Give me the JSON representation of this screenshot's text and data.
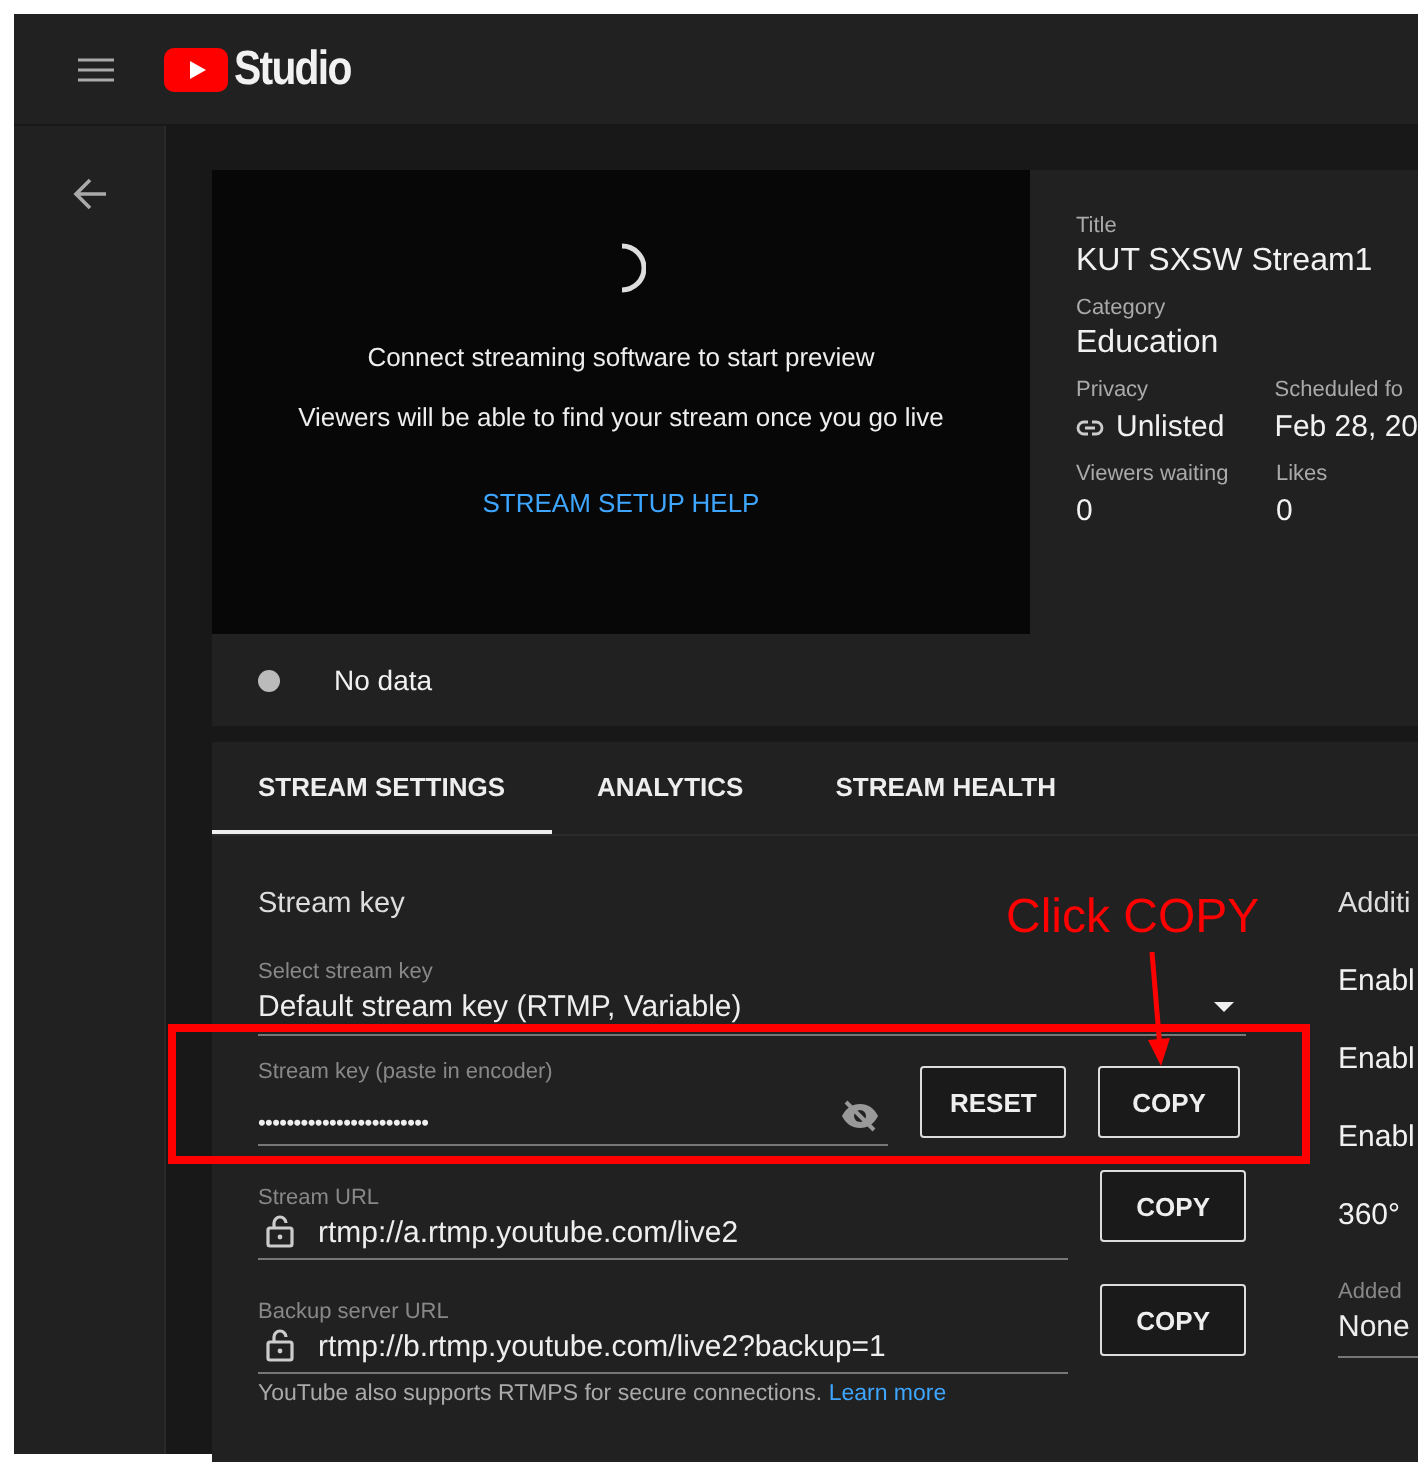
{
  "top_bar": {
    "logo_text": "Studio"
  },
  "preview": {
    "message": "Connect streaming software to start preview",
    "subtext": "Viewers will be able to find your stream once you go live",
    "help_link": "STREAM SETUP HELP"
  },
  "details": [
    {
      "label": "Title",
      "value": "KUT SXSW Stream1"
    },
    {
      "label": "Category",
      "value": "Education"
    }
  ],
  "details_pairs": [
    [
      {
        "label": "Privacy",
        "value": "Unlisted",
        "kind": "link"
      },
      {
        "label": "Scheduled fo",
        "value": "Feb 28, 20",
        "kind": "plain"
      }
    ],
    [
      {
        "label": "Viewers waiting",
        "value": "0",
        "kind": "plain"
      },
      {
        "label": "Likes",
        "value": "0",
        "kind": "plain"
      }
    ]
  ],
  "status": {
    "text": "No data"
  },
  "tabs": [
    {
      "label": "STREAM SETTINGS",
      "selected": true
    },
    {
      "label": "ANALYTICS",
      "selected": false
    },
    {
      "label": "STREAM HEALTH",
      "selected": false
    }
  ],
  "stream_key": {
    "heading": "Stream key",
    "select_label": "Select stream key",
    "select_value": "Default stream key (RTMP, Variable)",
    "key_label": "Stream key (paste in encoder)",
    "key_value": "••••••••••••••••••••••••",
    "reset_button": "RESET",
    "copy_button": "COPY"
  },
  "urls": [
    {
      "label": "Stream URL",
      "value": "rtmp://a.rtmp.youtube.com/live2",
      "button": "COPY"
    },
    {
      "label": "Backup server URL",
      "value": "rtmp://b.rtmp.youtube.com/live2?backup=1",
      "button": "COPY"
    }
  ],
  "note": {
    "text": "YouTube also supports RTMPS for secure connections.",
    "link": "Learn more"
  },
  "additional": {
    "heading": "Additi",
    "items": [
      "Enabl",
      "Enabl",
      "Enabl",
      "360°"
    ],
    "added_label": "Added",
    "added_value": "None"
  },
  "annotation": {
    "text": "Click COPY"
  }
}
